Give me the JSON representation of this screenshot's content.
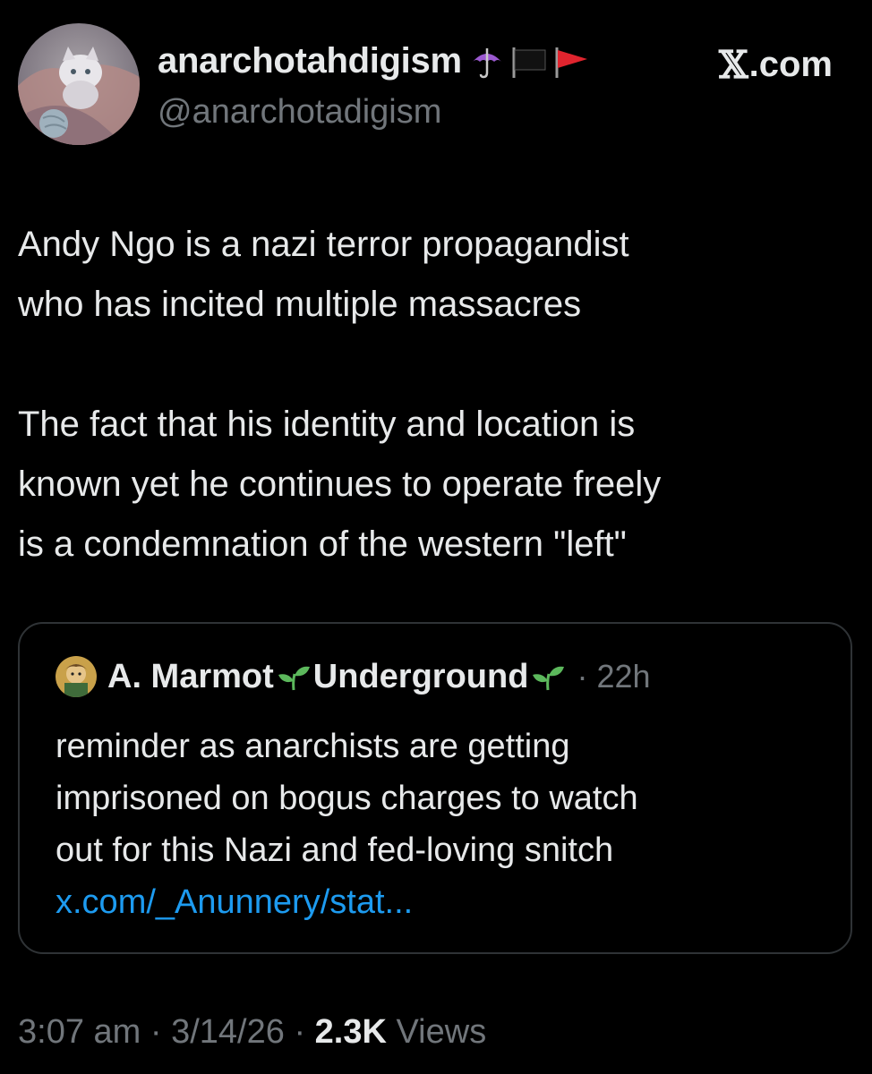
{
  "author": {
    "name": "anarchotahdigism",
    "handle": "@anarchotadigism",
    "name_emojis": [
      "umbrella-icon",
      "black-flag-icon",
      "red-flag-icon"
    ],
    "avatar": "cat-avatar"
  },
  "site": {
    "x_glyph": "𝕏",
    "label": ".com"
  },
  "tweet": {
    "text": "Andy Ngo is a nazi terror propagandist\nwho has incited multiple massacres\n\nThe fact that his identity and location is\nknown yet he continues to operate freely\nis a condemnation of the western \"left\""
  },
  "quote": {
    "name_part1": "A. Marmot",
    "name_part2": "Underground",
    "separator": "·",
    "time": "22h",
    "text": "reminder as anarchists are getting\nimprisoned on bogus charges to watch\nout for this Nazi and fed-loving snitch",
    "link": "x.com/_Anunnery/stat..."
  },
  "footer": {
    "time": "3:07 am",
    "sep1": " · ",
    "date": "3/14/26",
    "sep2": " · ",
    "views_count": "2.3K",
    "views_label": " Views"
  },
  "colors": {
    "background": "#000000",
    "text": "#e7e9ea",
    "secondary": "#71767b",
    "link": "#1d9bf0",
    "border": "#2f3336",
    "sprout": "#5cb85c",
    "umbrella": "#9b59d0",
    "red_flag": "#e0242e"
  }
}
